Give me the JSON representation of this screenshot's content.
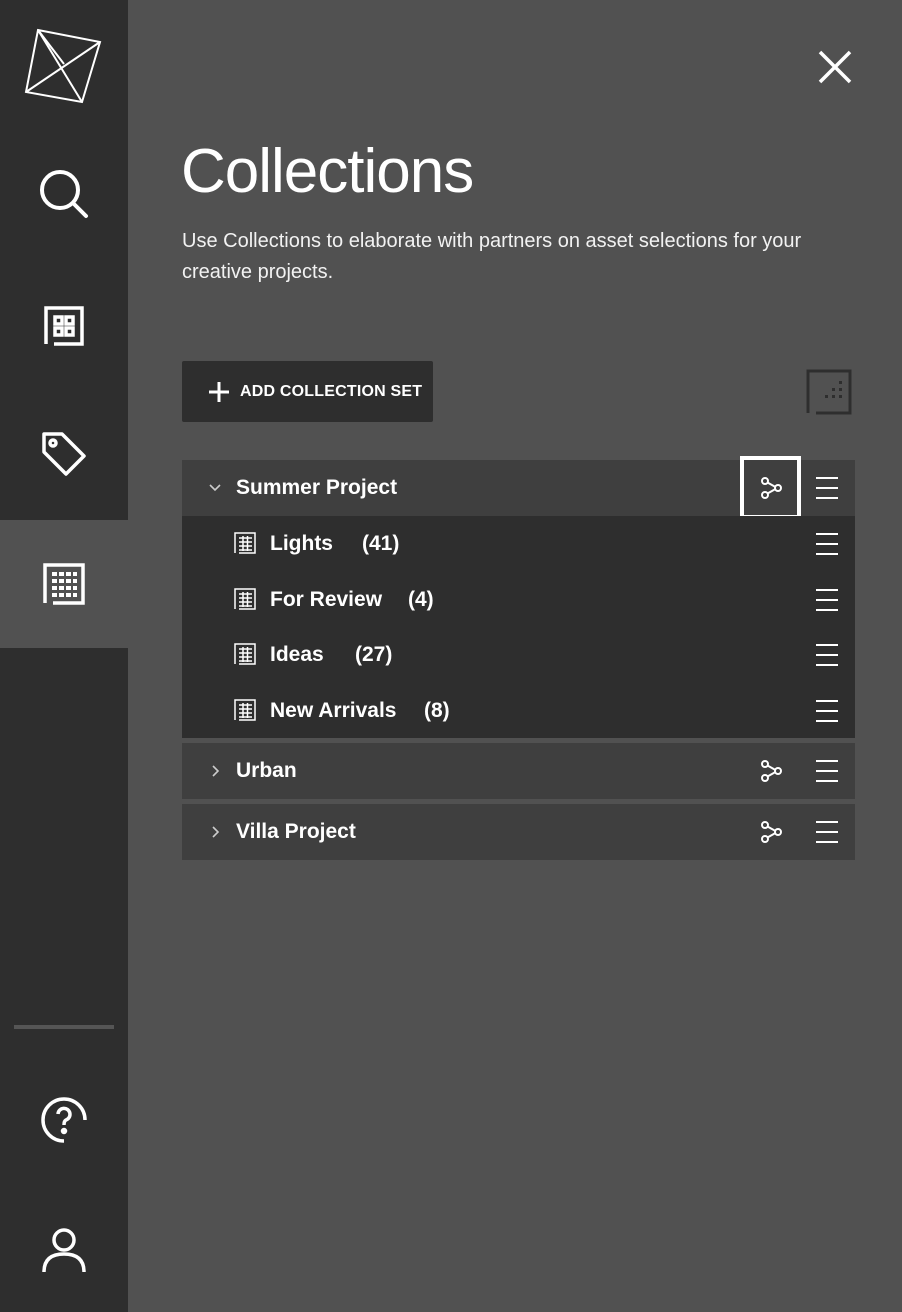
{
  "sidebar": {
    "items": [
      {
        "icon": "logo-icon"
      },
      {
        "icon": "search-icon"
      },
      {
        "icon": "dashboard-icon"
      },
      {
        "icon": "tag-icon"
      },
      {
        "icon": "collections-icon",
        "active": true
      },
      {
        "icon": "help-icon"
      },
      {
        "icon": "user-icon"
      }
    ]
  },
  "header": {
    "title": "Collections",
    "description": "Use Collections to elaborate with partners on asset selections for your creative projects."
  },
  "toolbar": {
    "add_label": "ADD COLLECTION SET"
  },
  "collection_sets": [
    {
      "name": "Summer Project",
      "expanded": true,
      "collections": [
        {
          "name": "Lights",
          "count": "(41)"
        },
        {
          "name": "For Review",
          "count": "(4)"
        },
        {
          "name": "Ideas",
          "count": "(27)"
        },
        {
          "name": "New Arrivals",
          "count": "(8)"
        }
      ]
    },
    {
      "name": "Urban",
      "expanded": false
    },
    {
      "name": "Villa Project",
      "expanded": false
    }
  ],
  "colors": {
    "sidebar_bg": "#2e2e2e",
    "main_bg": "#515151",
    "set_header_bg": "#3f3f3f",
    "child_bg": "#2e2e2e",
    "text": "#ffffff"
  }
}
